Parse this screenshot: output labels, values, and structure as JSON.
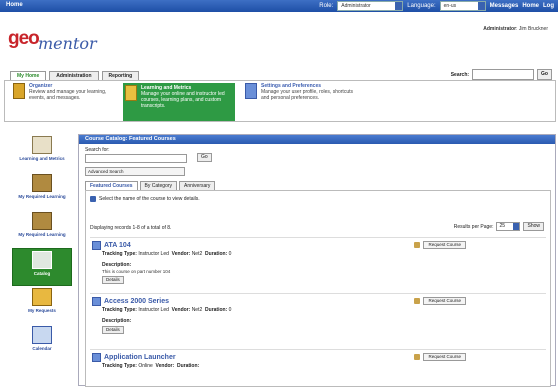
{
  "topbar": {
    "home_label": "Home",
    "role_label": "Role:",
    "role_value": "Administrator",
    "language_label": "Language:",
    "language_value": "en-us",
    "messages_label": "Messages",
    "help_label": "Home",
    "logout_label": "Log"
  },
  "logo": {
    "geo": "geo",
    "mentor": "mentor"
  },
  "admin": {
    "label": "Administrator",
    "name": "Jim Bruckner"
  },
  "tabs": [
    {
      "label": "My Home"
    },
    {
      "label": "Administration"
    },
    {
      "label": "Reporting"
    }
  ],
  "search": {
    "label": "Search:",
    "button": "Go"
  },
  "band": [
    {
      "title": "Organizer",
      "desc": "Review and manage your learning, events, and messages."
    },
    {
      "title": "Learning and Metrics",
      "desc": "Manage your online and instructor led courses, learning plans, and custom transcripts."
    },
    {
      "title": "Settings and Preferences",
      "desc": "Manage your user profile, roles, shortcuts and personal preferences."
    }
  ],
  "sidebar": [
    {
      "label": "Learning and Metrics"
    },
    {
      "label": "My Required Learning"
    },
    {
      "label": "My Required Learning"
    },
    {
      "label": "Catalog"
    },
    {
      "label": "My Requests"
    },
    {
      "label": "Calendar"
    }
  ],
  "main": {
    "header": "Course Catalog: Featured Courses",
    "search_for_label": "Search for:",
    "go_label": "Go",
    "advanced_label": "Advanced Search",
    "subtabs": [
      "Featured Courses",
      "By Category",
      "Anniversary"
    ],
    "info": "Select the name of the course to view details.",
    "displaying": "Displaying records 1-8 of a total of 8.",
    "rpp_label": "Results per Page:",
    "rpp_value": "25",
    "show_label": "Show"
  },
  "courses": [
    {
      "title": "ATA 104",
      "tracking_label": "Tracking Type:",
      "tracking": "Instructor Led",
      "vendor_label": "Vendor:",
      "vendor": "Net2",
      "duration_label": "Duration:",
      "duration": "0",
      "desc_label": "Description:",
      "desc": "This is course on part number 104",
      "details_label": "Details",
      "request_label": "Request Course"
    },
    {
      "title": "Access 2000 Series",
      "tracking_label": "Tracking Type:",
      "tracking": "Instructor Led",
      "vendor_label": "Vendor:",
      "vendor": "Net2",
      "duration_label": "Duration:",
      "duration": "0",
      "desc_label": "Description:",
      "desc": "",
      "details_label": "Details",
      "request_label": "Request Course"
    },
    {
      "title": "Application Launcher",
      "tracking_label": "Tracking Type:",
      "tracking": "Online",
      "vendor_label": "Vendor:",
      "vendor": "",
      "duration_label": "Duration:",
      "duration": "",
      "desc_label": "",
      "desc": "",
      "details_label": "",
      "request_label": "Request Course"
    }
  ]
}
